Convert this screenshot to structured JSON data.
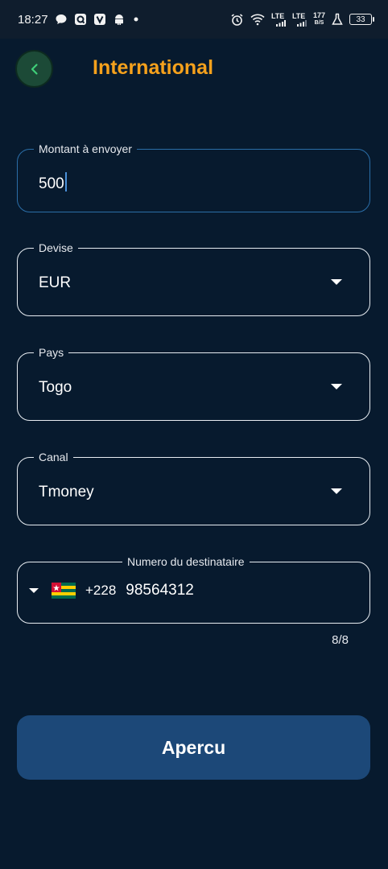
{
  "status_bar": {
    "time": "18:27",
    "net_lte_1": "LTE",
    "net_lte_2": "LTE",
    "net_speed_value": "177",
    "net_speed_unit": "B/S",
    "battery": "33"
  },
  "header": {
    "title": "International",
    "back_icon": "chevron-left-icon"
  },
  "form": {
    "amount": {
      "label": "Montant à envoyer",
      "value": "500"
    },
    "currency": {
      "label": "Devise",
      "value": "EUR"
    },
    "country": {
      "label": "Pays",
      "value": "Togo"
    },
    "channel": {
      "label": "Canal",
      "value": "Tmoney"
    },
    "recipient": {
      "label": "Numero du destinataire",
      "country_code": "+228",
      "number": "98564312",
      "counter": "8/8",
      "flag_icon": "togo-flag-icon"
    }
  },
  "actions": {
    "preview_label": "Apercu"
  },
  "colors": {
    "background": "#071a2e",
    "accent": "#f5a11c",
    "button": "#1c4878",
    "back_button": "#1c4a37",
    "active_border": "#2b6ea8"
  }
}
